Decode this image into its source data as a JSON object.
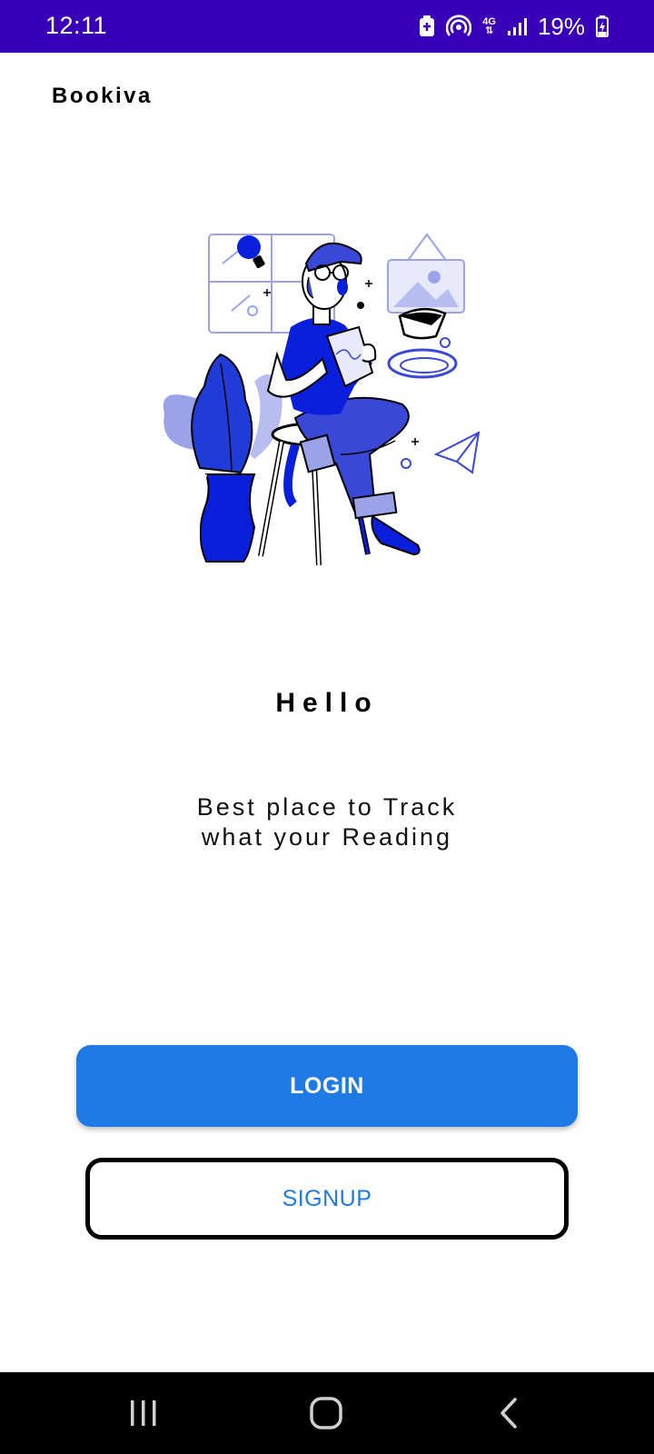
{
  "status_bar": {
    "time": "12:11",
    "network_type": "4G",
    "battery_percent": "19%",
    "background_color": "#3a00b8"
  },
  "app": {
    "title": "Bookiva"
  },
  "hero": {
    "illustration": "person-reading-on-stool-illustration",
    "accent_color": "#0a1fdc"
  },
  "content": {
    "heading": "Hello",
    "tagline_line1": "Best place to Track",
    "tagline_line2": "what your Reading"
  },
  "actions": {
    "login_label": "LOGIN",
    "signup_label": "SIGNUP",
    "primary_color": "#1e7be6"
  },
  "nav_bar": {
    "icons": [
      "recent-apps-icon",
      "home-icon",
      "back-icon"
    ]
  }
}
